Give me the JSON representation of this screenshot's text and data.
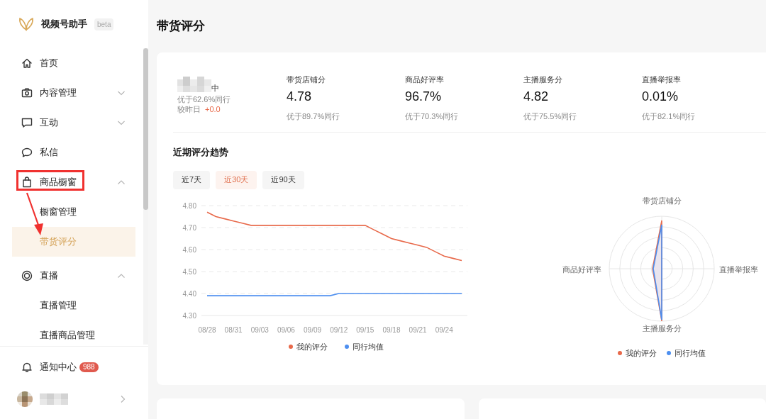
{
  "app": {
    "name": "视频号助手",
    "badge": "beta"
  },
  "sidebar": {
    "items": [
      {
        "label": "首页",
        "selected": false
      },
      {
        "label": "内容管理",
        "expanded": false,
        "selected": false
      },
      {
        "label": "互动",
        "expanded": false,
        "selected": false
      },
      {
        "label": "私信",
        "selected": false
      },
      {
        "label": "商品橱窗",
        "expanded": true,
        "selected": false,
        "children": [
          {
            "label": "橱窗管理",
            "selected": false
          },
          {
            "label": "带货评分",
            "selected": true
          }
        ]
      },
      {
        "label": "直播",
        "expanded": true,
        "selected": false,
        "children": [
          {
            "label": "直播管理",
            "selected": false
          },
          {
            "label": "直播商品管理",
            "selected": false
          }
        ]
      }
    ],
    "notifications": {
      "label": "通知中心",
      "badge": "988"
    }
  },
  "page": {
    "title": "带货评分"
  },
  "summary": {
    "level_suffix": "中",
    "peer": "优于62.6%同行",
    "change_label": "较昨日",
    "change": "+0.0"
  },
  "metrics": [
    {
      "label": "带货店铺分",
      "value": "4.78",
      "peer": "优于89.7%同行"
    },
    {
      "label": "商品好评率",
      "value": "96.7%",
      "peer": "优于70.3%同行"
    },
    {
      "label": "主播服务分",
      "value": "4.82",
      "peer": "优于75.5%同行"
    },
    {
      "label": "直播举报率",
      "value": "0.01%",
      "peer": "优于82.1%同行"
    }
  ],
  "trend": {
    "title": "近期评分趋势",
    "ranges": [
      {
        "label": "近7天",
        "selected": false
      },
      {
        "label": "近30天",
        "selected": true
      },
      {
        "label": "近90天",
        "selected": false
      }
    ],
    "chart_data": {
      "type": "line",
      "categories": [
        "08/28",
        null,
        null,
        "08/31",
        null,
        null,
        "09/03",
        null,
        null,
        "09/06",
        null,
        null,
        "09/09",
        null,
        null,
        "09/12",
        null,
        null,
        "09/15",
        null,
        null,
        "09/18",
        null,
        null,
        "09/21",
        null,
        null,
        "09/24",
        null,
        null
      ],
      "grid": true,
      "legend": "bottom",
      "series": [
        {
          "name": "我的评分",
          "color": "#e8694a",
          "values": [
            4.77,
            4.75,
            4.74,
            4.73,
            4.72,
            4.71,
            4.71,
            4.71,
            4.71,
            4.71,
            4.71,
            4.71,
            4.71,
            4.71,
            4.71,
            4.71,
            4.71,
            4.71,
            4.71,
            4.69,
            4.67,
            4.65,
            4.64,
            4.63,
            4.62,
            4.61,
            4.59,
            4.57,
            4.56,
            4.55
          ]
        },
        {
          "name": "同行均值",
          "color": "#4d8ff0",
          "values": [
            4.39,
            4.39,
            4.39,
            4.39,
            4.39,
            4.39,
            4.39,
            4.39,
            4.39,
            4.39,
            4.39,
            4.39,
            4.39,
            4.39,
            4.39,
            4.4,
            4.4,
            4.4,
            4.4,
            4.4,
            4.4,
            4.4,
            4.4,
            4.4,
            4.4,
            4.4,
            4.4,
            4.4,
            4.4,
            4.4
          ]
        }
      ],
      "ylim": [
        4.3,
        4.8
      ],
      "yticks": [
        {
          "value": 4.3,
          "label": "4.30"
        },
        {
          "value": 4.4,
          "label": "4.40"
        },
        {
          "value": 4.5,
          "label": "4.50"
        },
        {
          "value": 4.6,
          "label": "4.60"
        },
        {
          "value": 4.7,
          "label": "4.70"
        },
        {
          "value": 4.8,
          "label": "4.80"
        }
      ]
    },
    "radar": {
      "axes": [
        "带货店铺分",
        "直播举报率",
        "主播服务分",
        "商品好评率"
      ],
      "legend": [
        {
          "name": "我的评分",
          "color": "#e8694a"
        },
        {
          "name": "同行均值",
          "color": "#4d8ff0"
        }
      ]
    }
  }
}
